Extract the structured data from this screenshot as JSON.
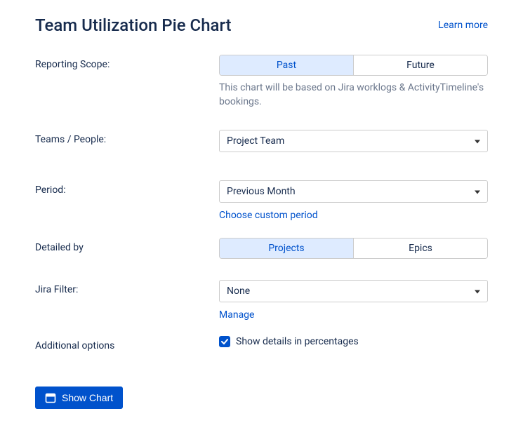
{
  "header": {
    "title": "Team Utilization Pie Chart",
    "learn_more": "Learn more"
  },
  "scope": {
    "label": "Reporting Scope:",
    "past": "Past",
    "future": "Future",
    "help": "This chart will be based on Jira worklogs & ActivityTimeline's bookings."
  },
  "teams": {
    "label": "Teams / People:",
    "value": "Project Team"
  },
  "period": {
    "label": "Period:",
    "value": "Previous Month",
    "custom_link": "Choose custom period"
  },
  "detailed": {
    "label": "Detailed by",
    "projects": "Projects",
    "epics": "Epics"
  },
  "filter": {
    "label": "Jira Filter:",
    "value": "None",
    "manage": "Manage"
  },
  "options": {
    "label": "Additional options",
    "show_details": "Show details in percentages"
  },
  "submit": {
    "label": "Show Chart"
  }
}
